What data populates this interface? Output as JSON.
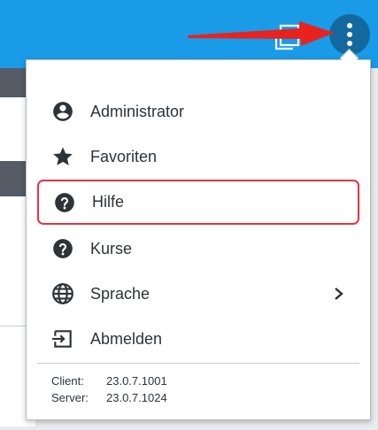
{
  "menu": {
    "items": [
      {
        "label": "Administrator",
        "icon": "account-circle-icon"
      },
      {
        "label": "Favoriten",
        "icon": "star-icon"
      },
      {
        "label": "Hilfe",
        "icon": "help-circle-icon"
      },
      {
        "label": "Kurse",
        "icon": "help-circle-icon"
      },
      {
        "label": "Sprache",
        "icon": "globe-icon"
      },
      {
        "label": "Abmelden",
        "icon": "logout-icon"
      }
    ],
    "highlighted_item": "Hilfe",
    "version": {
      "client_label": "Client:",
      "client_value": "23.0.7.1001",
      "server_label": "Server:",
      "server_value": "23.0.7.1024"
    }
  },
  "colors": {
    "topbar": "#1a9be8",
    "kebab_button": "#13699e",
    "highlight_border": "#e53340",
    "annotation_arrow": "#e8221f",
    "icon": "#2e3338"
  }
}
